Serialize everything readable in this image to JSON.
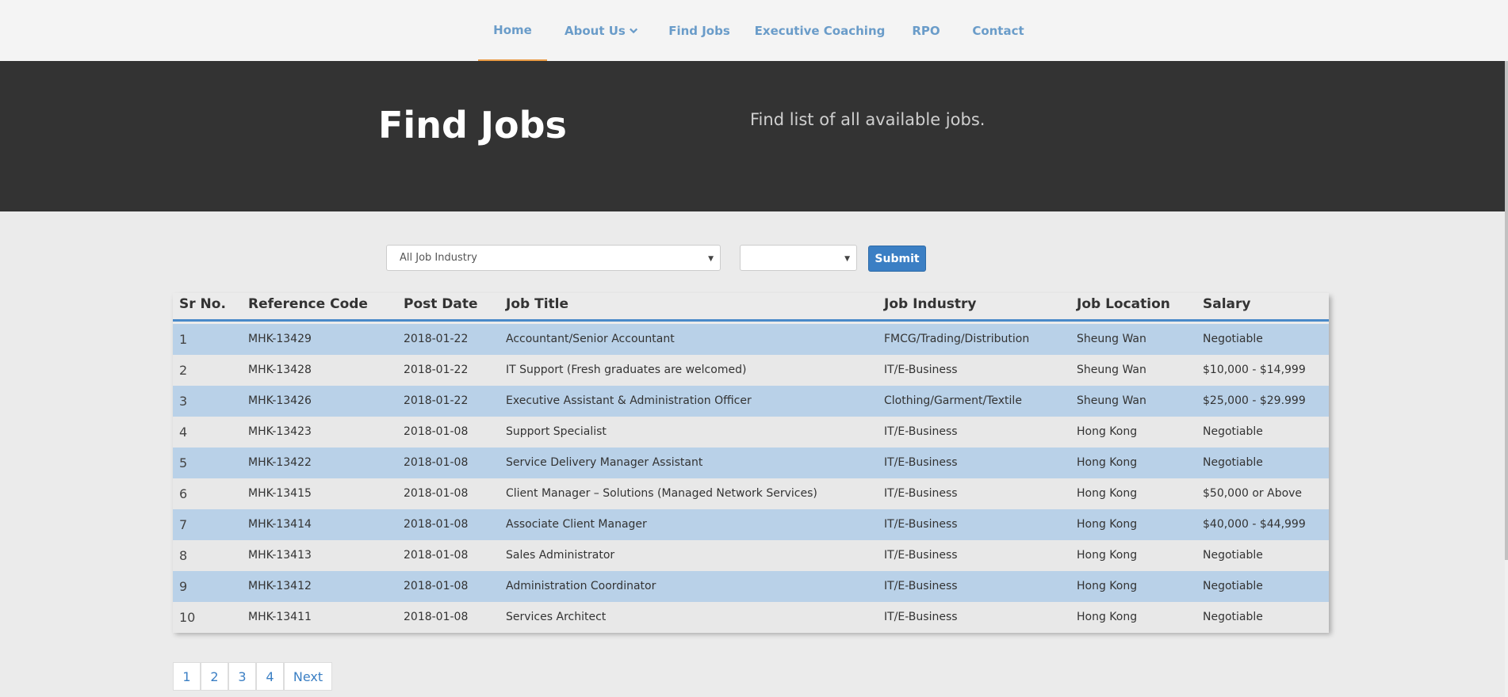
{
  "nav": {
    "items": [
      {
        "label": "Home",
        "active": true
      },
      {
        "label": "About Us",
        "dropdown": true
      },
      {
        "label": "Find Jobs"
      },
      {
        "label": "Executive Coaching"
      },
      {
        "label": "RPO"
      },
      {
        "label": "Contact"
      }
    ]
  },
  "hero": {
    "title": "Find Jobs",
    "subtitle": "Find list of all available jobs."
  },
  "filters": {
    "industry_selected": "All Job Industry",
    "second_selected": "",
    "submit_label": "Submit"
  },
  "table": {
    "headers": [
      "Sr No.",
      "Reference Code",
      "Post Date",
      "Job Title",
      "Job Industry",
      "Job Location",
      "Salary"
    ],
    "rows": [
      [
        "1",
        "MHK-13429",
        "2018-01-22",
        "Accountant/Senior Accountant",
        "FMCG/Trading/Distribution",
        "Sheung Wan",
        "Negotiable"
      ],
      [
        "2",
        "MHK-13428",
        "2018-01-22",
        "IT Support (Fresh graduates are welcomed)",
        "IT/E-Business",
        "Sheung Wan",
        "$10,000 - $14,999"
      ],
      [
        "3",
        "MHK-13426",
        "2018-01-22",
        "Executive Assistant & Administration Officer",
        "Clothing/Garment/Textile",
        "Sheung Wan",
        "$25,000 - $29.999"
      ],
      [
        "4",
        "MHK-13423",
        "2018-01-08",
        "Support Specialist",
        "IT/E-Business",
        "Hong Kong",
        "Negotiable"
      ],
      [
        "5",
        "MHK-13422",
        "2018-01-08",
        "Service Delivery Manager Assistant",
        "IT/E-Business",
        "Hong Kong",
        "Negotiable"
      ],
      [
        "6",
        "MHK-13415",
        "2018-01-08",
        "Client Manager – Solutions (Managed Network Services)",
        "IT/E-Business",
        "Hong Kong",
        "$50,000 or Above"
      ],
      [
        "7",
        "MHK-13414",
        "2018-01-08",
        "Associate Client Manager",
        "IT/E-Business",
        "Hong Kong",
        "$40,000 - $44,999"
      ],
      [
        "8",
        "MHK-13413",
        "2018-01-08",
        "Sales Administrator",
        "IT/E-Business",
        "Hong Kong",
        "Negotiable"
      ],
      [
        "9",
        "MHK-13412",
        "2018-01-08",
        "Administration Coordinator",
        "IT/E-Business",
        "Hong Kong",
        "Negotiable"
      ],
      [
        "10",
        "MHK-13411",
        "2018-01-08",
        "Services Architect",
        "IT/E-Business",
        "Hong Kong",
        "Negotiable"
      ]
    ]
  },
  "pagination": {
    "pages": [
      "1",
      "2",
      "3",
      "4"
    ],
    "next_label": "Next"
  },
  "colors": {
    "accent": "#6a9cc9",
    "active_underline": "#e89a45",
    "hero_bg": "#333333",
    "row_highlight": "#b9d1e8",
    "button": "#3b7fc4"
  }
}
